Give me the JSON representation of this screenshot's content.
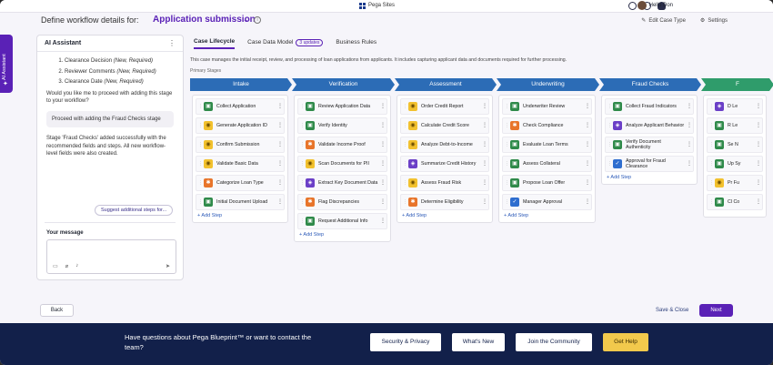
{
  "topbar": {
    "brand": "Pega Sites",
    "greeting": "Hello Don"
  },
  "header": {
    "prefix": "Define workflow details for:",
    "case_type": "Application submission",
    "edit_case_type": "Edit Case Type",
    "settings": "Settings"
  },
  "side_tab": {
    "label": "AI Assistant"
  },
  "ai_panel": {
    "title": "AI Assistant",
    "list": [
      {
        "name": "Clearance Decision",
        "note": "(New, Required)"
      },
      {
        "name": "Reviewer Comments",
        "note": "(New, Required)"
      },
      {
        "name": "Clearance Date",
        "note": "(New, Required)"
      }
    ],
    "question": "Would you like me to proceed with adding this stage to your workflow?",
    "user_reply": "Proceed with adding the Fraud Checks stage",
    "result": "Stage 'Fraud Checks' added successfully with the recommended fields and steps. All new workflow-level fields were also created.",
    "suggest_button": "Suggest additional steps for...",
    "message_label": "Your message"
  },
  "tabs": [
    {
      "label": "Case Lifecycle"
    },
    {
      "label": "Case Data Model",
      "badge": "3 updates"
    },
    {
      "label": "Business Rules"
    }
  ],
  "description": "This case manages the initial receipt, review, and processing of loan applications from applicants. It includes capturing applicant data and documents required for further processing.",
  "primary_stages_label": "Primary Stages",
  "add_step_label": "+ Add Step",
  "stages": [
    {
      "name": "Intake",
      "steps": [
        {
          "label": "Collect Application",
          "color": "g"
        },
        {
          "label": "Generate Application ID",
          "color": "y"
        },
        {
          "label": "Confirm Submission",
          "color": "y"
        },
        {
          "label": "Validate Basic Data",
          "color": "y"
        },
        {
          "label": "Categorize Loan Type",
          "color": "o"
        },
        {
          "label": "Initial Document Upload",
          "color": "g"
        }
      ]
    },
    {
      "name": "Verification",
      "steps": [
        {
          "label": "Review Application Data",
          "color": "g"
        },
        {
          "label": "Verify Identity",
          "color": "g"
        },
        {
          "label": "Validate Income Proof",
          "color": "o"
        },
        {
          "label": "Scan Documents for PII",
          "color": "y"
        },
        {
          "label": "Extract Key Document Data",
          "color": "p"
        },
        {
          "label": "Flag Discrepancies",
          "color": "o"
        },
        {
          "label": "Request Additional Info",
          "color": "g"
        }
      ]
    },
    {
      "name": "Assessment",
      "steps": [
        {
          "label": "Order Credit Report",
          "color": "y"
        },
        {
          "label": "Calculate Credit Score",
          "color": "y"
        },
        {
          "label": "Analyze Debt-to-Income",
          "color": "y"
        },
        {
          "label": "Summarize Credit History",
          "color": "p"
        },
        {
          "label": "Assess Fraud Risk",
          "color": "y"
        },
        {
          "label": "Determine Eligibility",
          "color": "o"
        }
      ]
    },
    {
      "name": "Underwriting",
      "steps": [
        {
          "label": "Underwriter Review",
          "color": "g"
        },
        {
          "label": "Check Compliance",
          "color": "o"
        },
        {
          "label": "Evaluate Loan Terms",
          "color": "g"
        },
        {
          "label": "Assess Collateral",
          "color": "g"
        },
        {
          "label": "Propose Loan Offer",
          "color": "g"
        },
        {
          "label": "Manager Approval",
          "color": "b"
        }
      ]
    },
    {
      "name": "Fraud Checks",
      "steps": [
        {
          "label": "Collect Fraud Indicators",
          "color": "g"
        },
        {
          "label": "Analyze Applicant Behavior",
          "color": "p"
        },
        {
          "label": "Verify Document Authenticity",
          "color": "g"
        },
        {
          "label": "Approval for Fraud Clearance",
          "color": "b"
        }
      ]
    },
    {
      "name": "F",
      "steps": [
        {
          "label": "D Le",
          "color": "p"
        },
        {
          "label": "R Le",
          "color": "g"
        },
        {
          "label": "Se N",
          "color": "g"
        },
        {
          "label": "Up Sy",
          "color": "g"
        },
        {
          "label": "Pr Fu",
          "color": "y"
        },
        {
          "label": "Cl Co",
          "color": "g"
        }
      ]
    }
  ],
  "footer": {
    "back": "Back",
    "save_close": "Save & Close",
    "next": "Next"
  },
  "banner": {
    "text": "Have questions about Pega Blueprint™ or want to contact the team?",
    "buttons": [
      "Security & Privacy",
      "What's New",
      "Join the Community",
      "Get Help"
    ]
  },
  "colors": {
    "accent": "#5a21b6",
    "stage": "#2c6cb6",
    "banner": "#12204a",
    "help": "#f2c94c"
  }
}
